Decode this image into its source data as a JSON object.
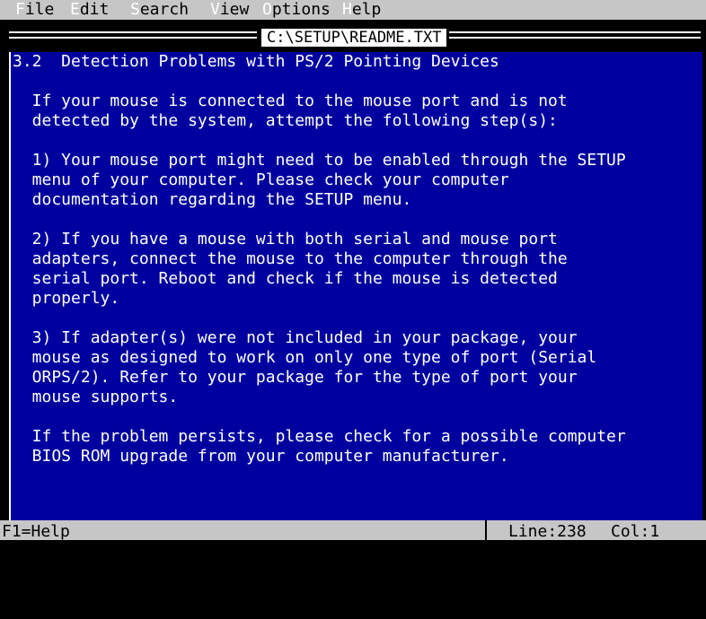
{
  "menu": {
    "items": [
      {
        "hot": "F",
        "rest": "ile"
      },
      {
        "hot": "E",
        "rest": "dit"
      },
      {
        "hot": "S",
        "rest": "earch"
      },
      {
        "hot": "V",
        "rest": "iew"
      },
      {
        "hot": "O",
        "rest": "ptions"
      },
      {
        "hot": "H",
        "rest": "elp"
      }
    ]
  },
  "window": {
    "title": "C:\\SETUP\\README.TXT"
  },
  "document": {
    "lines": [
      "3.2  Detection Problems with PS/2 Pointing Devices",
      "",
      "  If your mouse is connected to the mouse port and is not",
      "  detected by the system, attempt the following step(s):",
      "",
      "  1) Your mouse port might need to be enabled through the SETUP",
      "  menu of your computer. Please check your computer",
      "  documentation regarding the SETUP menu.",
      "",
      "  2) If you have a mouse with both serial and mouse port",
      "  adapters, connect the mouse to the computer through the",
      "  serial port. Reboot and check if the mouse is detected",
      "  properly.",
      "",
      "  3) If adapter(s) were not included in your package, your",
      "  mouse as designed to work on only one type of port (Serial",
      "  ORPS/2). Refer to your package for the type of port your",
      "  mouse supports.",
      "",
      "  If the problem persists, please check for a possible computer",
      "  BIOS ROM upgrade from your computer manufacturer."
    ]
  },
  "status": {
    "help": "F1=Help",
    "line": "Line:238",
    "col": "Col:1"
  },
  "colors": {
    "background": "#00009f",
    "text": "#ffffff",
    "bars": "#c6c6c6"
  }
}
